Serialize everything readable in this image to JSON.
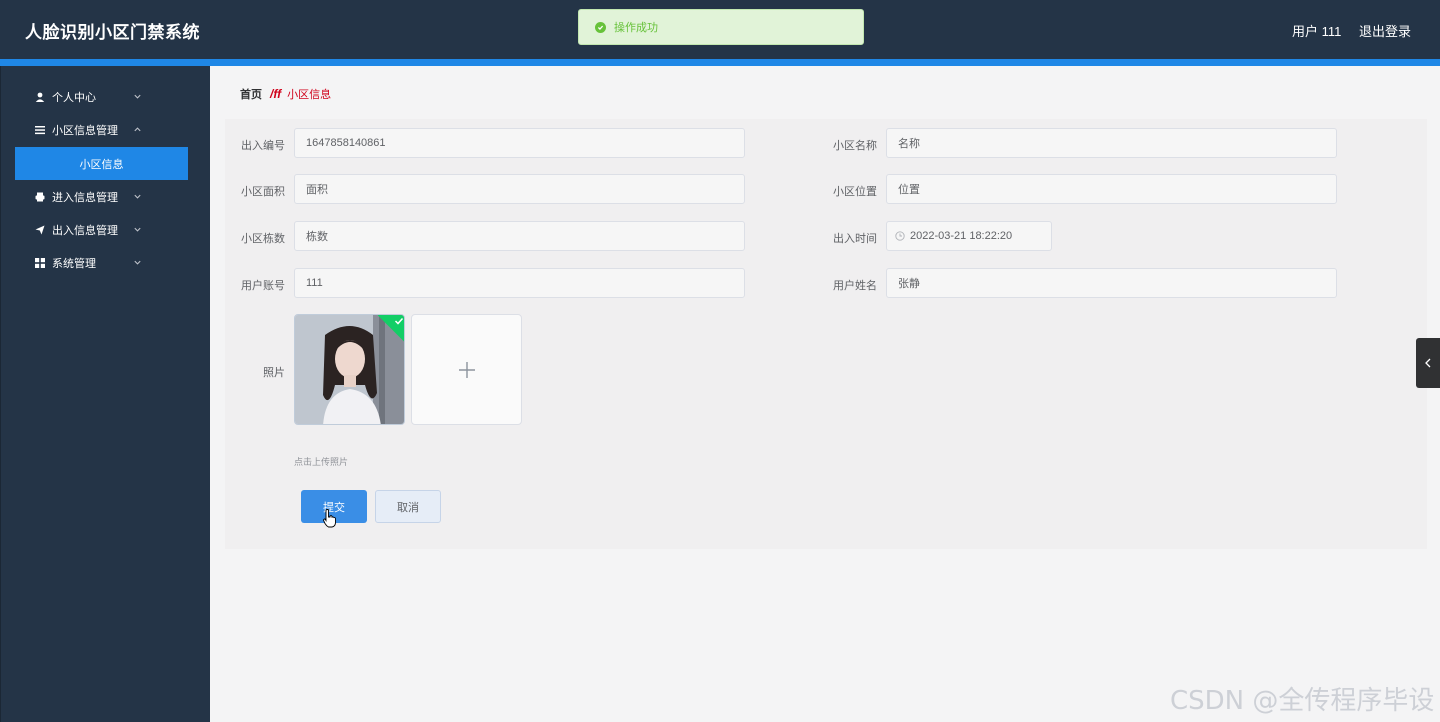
{
  "header": {
    "title": "人脸识别小区门禁系统",
    "user_label": "用户 111",
    "logout_label": "退出登录"
  },
  "toast": {
    "message": "操作成功"
  },
  "sidebar": {
    "items": [
      {
        "label": "个人中心",
        "icon": "user-icon"
      },
      {
        "label": "小区信息管理",
        "icon": "list-icon"
      },
      {
        "label": "小区信息",
        "icon": ""
      },
      {
        "label": "进入信息管理",
        "icon": "printer-icon"
      },
      {
        "label": "出入信息管理",
        "icon": "send-icon"
      },
      {
        "label": "系统管理",
        "icon": "grid-icon"
      }
    ]
  },
  "breadcrumb": {
    "home": "首页",
    "separator": "/ff",
    "current": "小区信息"
  },
  "form": {
    "fields": {
      "code": {
        "label": "出入编号",
        "value": "1647858140861"
      },
      "name": {
        "label": "小区名称",
        "value": "名称"
      },
      "area": {
        "label": "小区面积",
        "value": "面积"
      },
      "location": {
        "label": "小区位置",
        "value": "位置"
      },
      "buildings": {
        "label": "小区栋数",
        "value": "栋数"
      },
      "time": {
        "label": "出入时间",
        "value": "2022-03-21 18:22:20"
      },
      "account": {
        "label": "用户账号",
        "value": "111"
      },
      "username": {
        "label": "用户姓名",
        "value": "张静"
      }
    },
    "photo": {
      "label": "照片",
      "tip": "点击上传照片"
    },
    "submit_label": "提交",
    "cancel_label": "取消"
  },
  "watermark": "CSDN @全传程序毕设",
  "colors": {
    "header": "#243447",
    "accent": "#1f87e6",
    "success": "#67c23a"
  }
}
